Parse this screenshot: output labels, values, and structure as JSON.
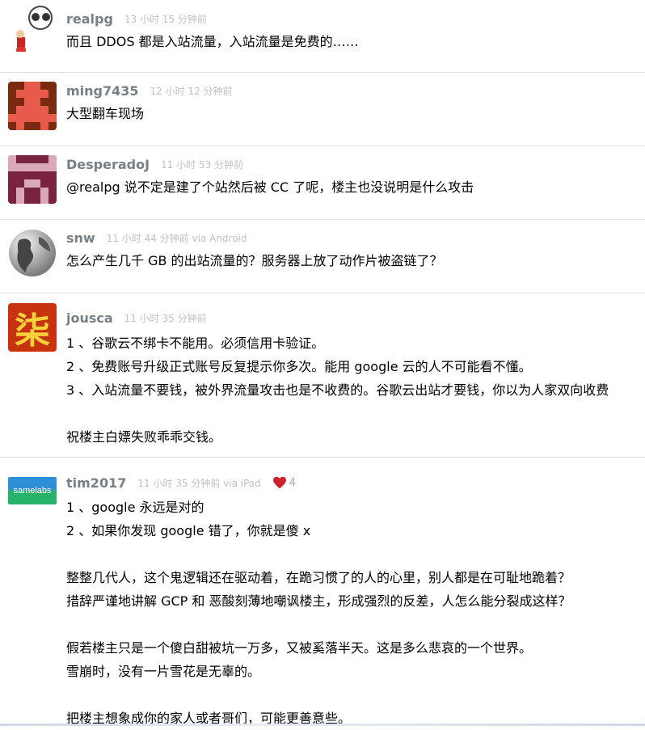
{
  "replies": [
    {
      "username": "realpg",
      "time": "13 小时 15 分钟前",
      "avatar_icon": "cartoon-rider-avatar",
      "lines": [
        "而且 DDOS 都是入站流量，入站流量是免费的……"
      ]
    },
    {
      "username": "ming7435",
      "time": "12 小时 12 分钟前",
      "avatar_icon": "pixel-identicon-red",
      "lines": [
        "大型翻车现场"
      ]
    },
    {
      "username": "DesperadoJ",
      "time": "11 小时 53 分钟前",
      "avatar_icon": "pixel-identicon-maroon",
      "lines": [
        "@realpg 说不定是建了个站然后被 CC 了呢，楼主也没说明是什么攻击"
      ]
    },
    {
      "username": "snw",
      "time": "11 小时 44 分钟前 via Android",
      "avatar_icon": "globe-avatar",
      "lines": [
        "怎么产生几千 GB 的出站流量的？服务器上放了动作片被盗链了？"
      ]
    },
    {
      "username": "jousca",
      "time": "11 小时 35 分钟前",
      "avatar_icon": "chinese-character-avatar",
      "avatar_text": "柒",
      "lines": [
        "1 、谷歌云不绑卡不能用。必须信用卡验证。",
        "2 、免费账号升级正式账号反复提示你多次。能用 google 云的人不可能看不懂。",
        "3 、入站流量不要钱，被外界流量攻击也是不收费的。谷歌云出站才要钱，你以为人家双向收费",
        "",
        "祝楼主白嫖失败乖乖交钱。"
      ]
    },
    {
      "username": "tim2017",
      "time": "11 小时 35 分钟前 via iPad",
      "avatar_icon": "samelabs-logo-avatar",
      "avatar_text": "samelabs",
      "thanks_count": "4",
      "lines": [
        "1 、google 永远是对的",
        "2 、如果你发现 google 错了，你就是傻 x",
        "",
        "整整几代人，这个鬼逻辑还在驱动着，在跪习惯了的人的心里，别人都是在可耻地跪着？",
        "措辞严谨地讲解 GCP 和 恶酸刻薄地嘲讽楼主，形成强烈的反差，人怎么能分裂成这样？",
        "",
        "假若楼主只是一个傻白甜被坑一万多，又被奚落半天。这是多么悲哀的一个世界。",
        "雪崩时，没有一片雪花是无辜的。",
        "",
        "把楼主想象成你的家人或者哥们，可能更善意些。"
      ]
    }
  ],
  "colors": {
    "username": "#778087",
    "time": "#c0c0c0",
    "divider": "#e2e2e2",
    "heart": "#c9252c"
  }
}
